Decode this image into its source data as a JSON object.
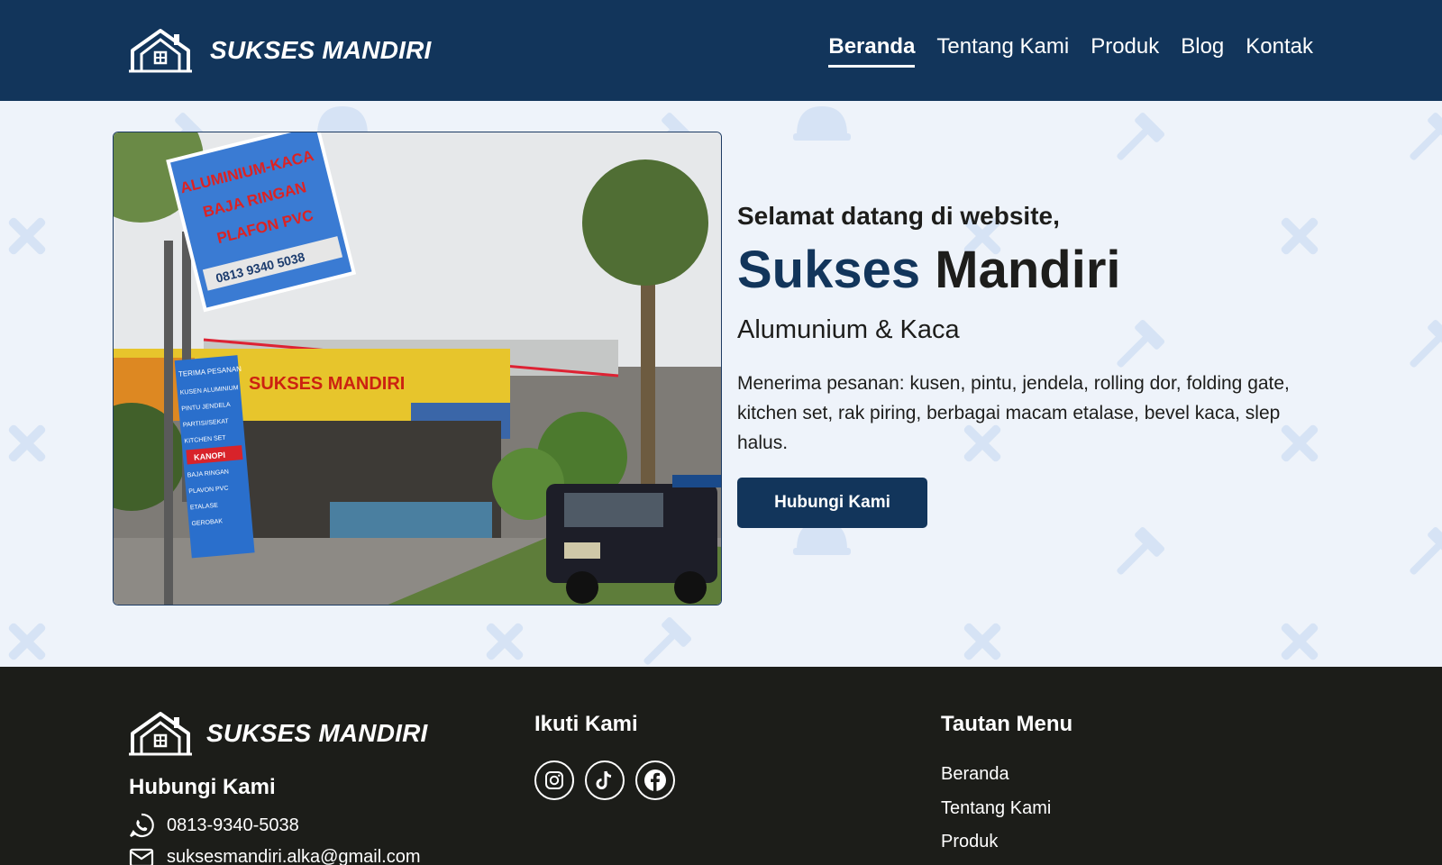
{
  "header": {
    "brand": "SUKSES MANDIRI",
    "nav": [
      {
        "label": "Beranda",
        "active": true
      },
      {
        "label": "Tentang Kami",
        "active": false
      },
      {
        "label": "Produk",
        "active": false
      },
      {
        "label": "Blog",
        "active": false
      },
      {
        "label": "Kontak",
        "active": false
      }
    ]
  },
  "hero": {
    "welcome": "Selamat datang di website,",
    "title_part1": "Sukses",
    "title_part2": "Mandiri",
    "subtitle": "Alumunium & Kaca",
    "description": "Menerima pesanan: kusen, pintu, jendela, rolling dor, folding gate, kitchen set, rak piring, berbagai macam etalase, bevel kaca, slep halus.",
    "cta": "Hubungi Kami",
    "photo_sign": {
      "lines": [
        "ALUMINIUM-KACA",
        "BAJA RINGAN",
        "PLAFON PVC"
      ],
      "phone": "0813 9340 5038",
      "banner_name": "SUKSES MANDIRI",
      "side_board": [
        "TERIMA PESANAN",
        "KUSEN ALUMINIUM",
        "PINTU JENDELA",
        "PARTISI/SEKAT",
        "KITCHEN SET",
        "KANOPI",
        "BAJA RINGAN",
        "PLAVON PVC",
        "ETALASE",
        "GEROBAK"
      ]
    }
  },
  "footer": {
    "brand": "SUKSES MANDIRI",
    "contact_title": "Hubungi Kami",
    "phone": "0813-9340-5038",
    "email": "suksesmandiri.alka@gmail.com",
    "follow_title": "Ikuti Kami",
    "socials": [
      "instagram-icon",
      "tiktok-icon",
      "facebook-icon"
    ],
    "menu_title": "Tautan Menu",
    "menu_links": [
      "Beranda",
      "Tentang Kami",
      "Produk"
    ]
  },
  "colors": {
    "primary": "#12355b",
    "footer_bg": "#1c1d19",
    "hero_bg": "#eef3fa"
  }
}
